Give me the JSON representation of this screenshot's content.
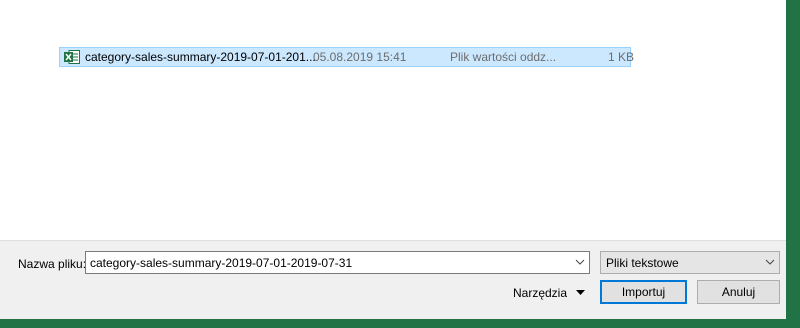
{
  "file_list": {
    "rows": [
      {
        "name": "category-sales-summary-2019-07-01-201...",
        "date": "05.08.2019 15:41",
        "type": "Plik wartości oddz...",
        "size": "1 KB"
      }
    ]
  },
  "footer": {
    "filename_label": "Nazwa pliku:",
    "filename_value": "category-sales-summary-2019-07-01-2019-07-31",
    "filetype_value": "Pliki tekstowe",
    "tools_label": "Narzędzia",
    "import_label": "Importuj",
    "cancel_label": "Anuluj"
  },
  "colors": {
    "excel_green": "#217346",
    "selection": "#cce8ff",
    "focus_border": "#0078d7"
  },
  "icons": {
    "file": "excel-csv-icon",
    "dropdown": "chevron-down-icon",
    "tools_menu": "triangle-down-icon"
  }
}
